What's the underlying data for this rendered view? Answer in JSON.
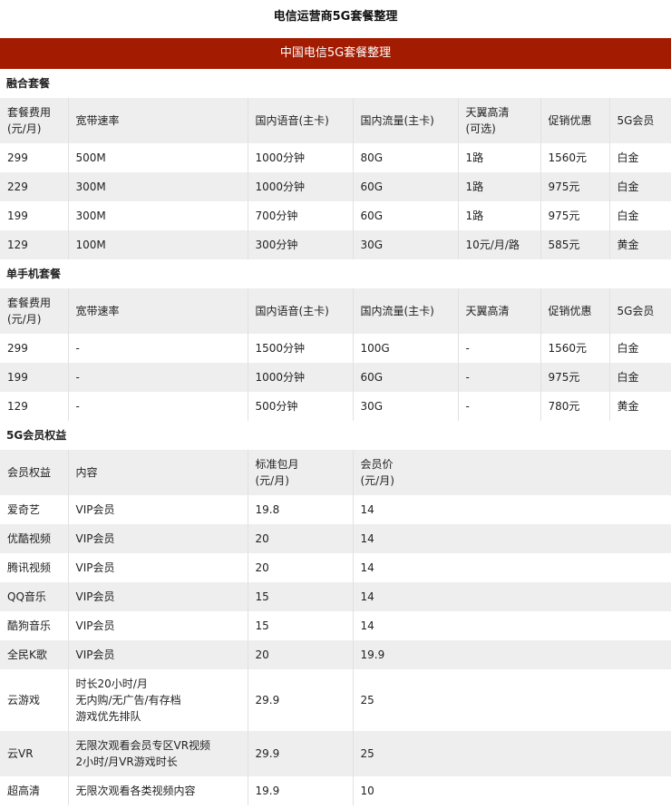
{
  "page_title": "电信运营商5G套餐整理",
  "banner_title": "中国电信5G套餐整理",
  "sections": [
    {
      "title": "融合套餐",
      "headers": [
        "套餐费用\n(元/月)",
        "宽带速率",
        "国内语音(主卡)",
        "国内流量(主卡)",
        "天翼高清\n(可选)",
        "促销优惠",
        "5G会员"
      ],
      "rows": [
        [
          "299",
          "500M",
          "1000分钟",
          "80G",
          "1路",
          "1560元",
          "白金"
        ],
        [
          "229",
          "300M",
          "1000分钟",
          "60G",
          "1路",
          "975元",
          "白金"
        ],
        [
          "199",
          "300M",
          "700分钟",
          "60G",
          "1路",
          "975元",
          "白金"
        ],
        [
          "129",
          "100M",
          "300分钟",
          "30G",
          "10元/月/路",
          "585元",
          "黄金"
        ]
      ]
    },
    {
      "title": "单手机套餐",
      "headers": [
        "套餐费用\n(元/月)",
        "宽带速率",
        "国内语音(主卡)",
        "国内流量(主卡)",
        "天翼高清",
        "促销优惠",
        "5G会员"
      ],
      "rows": [
        [
          "299",
          "-",
          "1500分钟",
          "100G",
          "-",
          "1560元",
          "白金"
        ],
        [
          "199",
          "-",
          "1000分钟",
          "60G",
          "-",
          "975元",
          "白金"
        ],
        [
          "129",
          "-",
          "500分钟",
          "30G",
          "-",
          "780元",
          "黄金"
        ]
      ]
    },
    {
      "title": "5G会员权益",
      "headers": [
        "会员权益",
        "内容",
        "标准包月\n(元/月)",
        "会员价\n(元/月)"
      ],
      "rows": [
        [
          "爱奇艺",
          "VIP会员",
          "19.8",
          "14"
        ],
        [
          "优酷视频",
          "VIP会员",
          "20",
          "14"
        ],
        [
          "腾讯视频",
          "VIP会员",
          "20",
          "14"
        ],
        [
          "QQ音乐",
          "VIP会员",
          "15",
          "14"
        ],
        [
          "酷狗音乐",
          "VIP会员",
          "15",
          "14"
        ],
        [
          "全民K歌",
          "VIP会员",
          "20",
          "19.9"
        ],
        [
          "云游戏",
          "时长20小时/月\n无内购/无广告/有存档\n游戏优先排队",
          "29.9",
          "25"
        ],
        [
          "云VR",
          "无限次观看会员专区VR视频\n2小时/月VR游戏时长",
          "29.9",
          "25"
        ],
        [
          "超高清",
          "无限次观看各类视频内容",
          "19.9",
          "10"
        ]
      ]
    }
  ]
}
